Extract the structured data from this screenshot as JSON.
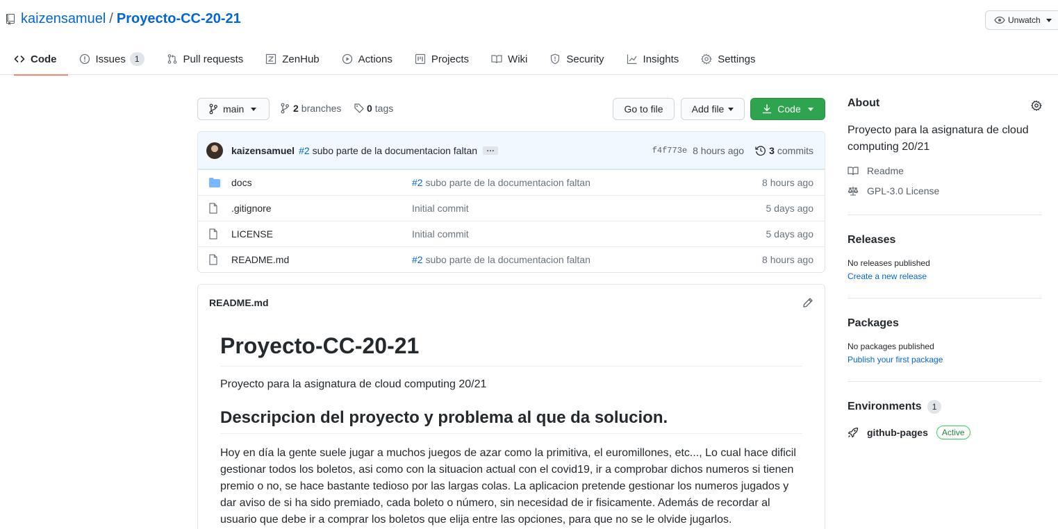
{
  "repo": {
    "owner": "kaizensamuel",
    "separator": "/",
    "name": "Proyecto-CC-20-21",
    "watch_label": "Unwatch"
  },
  "tabs": [
    {
      "label": "Code",
      "icon": "code-icon"
    },
    {
      "label": "Issues",
      "icon": "issue-icon",
      "count": "1"
    },
    {
      "label": "Pull requests",
      "icon": "pull-request-icon"
    },
    {
      "label": "ZenHub",
      "icon": "zenhub-icon"
    },
    {
      "label": "Actions",
      "icon": "play-icon"
    },
    {
      "label": "Projects",
      "icon": "project-icon"
    },
    {
      "label": "Wiki",
      "icon": "book-icon"
    },
    {
      "label": "Security",
      "icon": "shield-icon"
    },
    {
      "label": "Insights",
      "icon": "graph-icon"
    },
    {
      "label": "Settings",
      "icon": "gear-icon"
    }
  ],
  "branch_bar": {
    "branch": "main",
    "branches_count": "2",
    "branches_label": "branches",
    "tags_count": "0",
    "tags_label": "tags",
    "go_to_file": "Go to file",
    "add_file": "Add file",
    "code": "Code"
  },
  "latest_commit": {
    "author": "kaizensamuel",
    "ref": "#2",
    "message": "subo parte de la documentacion faltan",
    "ellipsis": "…",
    "sha": "f4f773e",
    "time": "8 hours ago",
    "commits_count": "3",
    "commits_label": "commits"
  },
  "files": [
    {
      "type": "folder",
      "name": "docs",
      "ref": "#2",
      "message": "subo parte de la documentacion faltan",
      "age": "8 hours ago"
    },
    {
      "type": "file",
      "name": ".gitignore",
      "ref": "",
      "message": "Initial commit",
      "age": "5 days ago"
    },
    {
      "type": "file",
      "name": "LICENSE",
      "ref": "",
      "message": "Initial commit",
      "age": "5 days ago"
    },
    {
      "type": "file",
      "name": "README.md",
      "ref": "#2",
      "message": "subo parte de la documentacion faltan",
      "age": "8 hours ago"
    }
  ],
  "readme": {
    "filename": "README.md",
    "h1": "Proyecto-CC-20-21",
    "intro": "Proyecto para la asignatura de cloud computing 20/21",
    "h2": "Descripcion del proyecto y problema al que da solucion.",
    "body": "Hoy en día la gente suele jugar a muchos juegos de azar como la primitiva, el euromillones, etc..., Lo cual hace dificil gestionar todos los boletos, asi como con la situacion actual con el covid19, ir a comprobar dichos numeros si tienen premio o no, se hace bastante tedioso por las largas colas. La aplicacion pretende gestionar los numeros jugados y dar aviso de si ha sido premiado, cada boleto o número, sin necesidad de ir fisicamente. Además de recordar al usuario que debe ir a comprar los boletos que elija entre las opciones, para que no se le olvide jugarlos."
  },
  "sidebar": {
    "about_title": "About",
    "about_desc": "Proyecto para la asignatura de cloud computing 20/21",
    "readme_link": "Readme",
    "license_link": "GPL-3.0 License",
    "releases_title": "Releases",
    "releases_note": "No releases published",
    "releases_link": "Create a new release",
    "packages_title": "Packages",
    "packages_note": "No packages published",
    "packages_link": "Publish your first package",
    "environments_title": "Environments",
    "environments_count": "1",
    "env_name": "github-pages",
    "env_status": "Active"
  },
  "colors": {
    "link": "#0366d6",
    "tab_underline": "#f9826c",
    "code_button": "#2ea44f",
    "commit_bg": "#f1f8ff",
    "folder": "#79b8ff",
    "active_badge": "#22863a"
  }
}
